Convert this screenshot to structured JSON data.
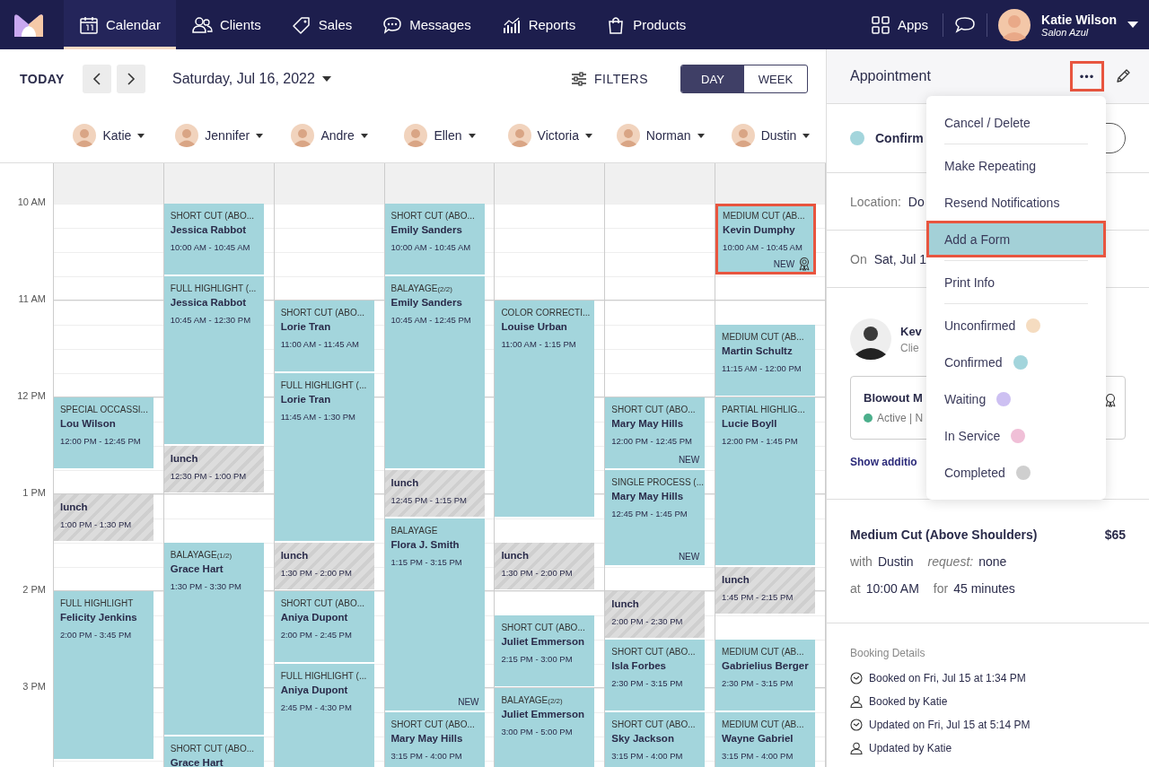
{
  "nav": {
    "items": [
      {
        "label": "Calendar",
        "selected": true
      },
      {
        "label": "Clients",
        "selected": false
      },
      {
        "label": "Sales",
        "selected": false
      },
      {
        "label": "Messages",
        "selected": false
      },
      {
        "label": "Reports",
        "selected": false
      },
      {
        "label": "Products",
        "selected": false
      }
    ],
    "apps": "Apps",
    "user": {
      "name": "Katie Wilson",
      "salon": "Salon Azul"
    }
  },
  "toolbar": {
    "today": "TODAY",
    "date": "Saturday, Jul 16, 2022",
    "filters": "FILTERS",
    "views": [
      {
        "label": "DAY",
        "selected": true
      },
      {
        "label": "WEEK",
        "selected": false
      }
    ]
  },
  "hours": [
    "10 AM",
    "11 AM",
    "12 PM",
    "1 PM",
    "2 PM",
    "3 PM"
  ],
  "staff": [
    {
      "name": "Katie",
      "events": [
        {
          "kind": "appointment",
          "service": "SPECIAL OCCASSI...",
          "client": "Lou Wilson",
          "time": "12:00 PM - 12:45 PM",
          "highlighted": false
        },
        {
          "kind": "break",
          "label": "lunch",
          "time": "1:00 PM - 1:30 PM"
        },
        {
          "kind": "appointment",
          "service": "FULL HIGHLIGHT",
          "client": "Felicity Jenkins",
          "time": "2:00 PM - 3:45 PM",
          "highlighted": false
        }
      ]
    },
    {
      "name": "Jennifer",
      "events": [
        {
          "kind": "appointment",
          "service": "SHORT CUT (ABO...",
          "client": "Jessica Rabbot",
          "time": "10:00 AM - 10:45 AM",
          "highlighted": false
        },
        {
          "kind": "appointment",
          "service": "FULL HIGHLIGHT (...",
          "client": "Jessica Rabbot",
          "time": "10:45 AM - 12:30 PM",
          "highlighted": false
        },
        {
          "kind": "break",
          "label": "lunch",
          "time": "12:30 PM - 1:00 PM"
        },
        {
          "kind": "appointment",
          "service": "BALAYAGE",
          "part": "(1/2)",
          "client": "Grace Hart",
          "time": "1:30 PM - 3:30 PM",
          "highlighted": false
        },
        {
          "kind": "appointment",
          "service": "SHORT CUT (ABO...",
          "client": "Grace Hart",
          "highlighted": false
        }
      ]
    },
    {
      "name": "Andre",
      "events": [
        {
          "kind": "appointment",
          "service": "SHORT CUT (ABO...",
          "client": "Lorie Tran",
          "time": "11:00 AM - 11:45 AM",
          "highlighted": false
        },
        {
          "kind": "appointment",
          "service": "FULL HIGHLIGHT (...",
          "client": "Lorie Tran",
          "time": "11:45 AM - 1:30 PM",
          "highlighted": false
        },
        {
          "kind": "break",
          "label": "lunch",
          "time": "1:30 PM - 2:00 PM"
        },
        {
          "kind": "appointment",
          "service": "SHORT CUT (ABO...",
          "client": "Aniya Dupont",
          "time": "2:00 PM - 2:45 PM",
          "highlighted": false
        },
        {
          "kind": "appointment",
          "service": "FULL HIGHLIGHT (...",
          "client": "Aniya Dupont",
          "time": "2:45 PM - 4:30 PM",
          "highlighted": false
        }
      ]
    },
    {
      "name": "Ellen",
      "events": [
        {
          "kind": "appointment",
          "service": "SHORT CUT (ABO...",
          "client": "Emily Sanders",
          "time": "10:00 AM - 10:45 AM",
          "highlighted": false
        },
        {
          "kind": "appointment",
          "service": "BALAYAGE",
          "part": "(2/2)",
          "client": "Emily Sanders",
          "time": "10:45 AM - 12:45 PM",
          "highlighted": false
        },
        {
          "kind": "break",
          "label": "lunch",
          "time": "12:45 PM - 1:15 PM"
        },
        {
          "kind": "appointment",
          "service": "BALAYAGE",
          "client": "Flora J. Smith",
          "time": "1:15 PM - 3:15 PM",
          "tag": "NEW",
          "highlighted": false
        },
        {
          "kind": "appointment",
          "service": "SHORT CUT (ABO...",
          "client": "Mary May Hills",
          "time": "3:15 PM - 4:00 PM",
          "highlighted": false
        }
      ]
    },
    {
      "name": "Victoria",
      "events": [
        {
          "kind": "appointment",
          "service": "COLOR CORRECTI...",
          "client": "Louise Urban",
          "time": "11:00 AM - 1:15 PM",
          "highlighted": false
        },
        {
          "kind": "break",
          "label": "lunch",
          "time": "1:30 PM - 2:00 PM"
        },
        {
          "kind": "appointment",
          "service": "SHORT CUT (ABO...",
          "client": "Juliet Emmerson",
          "time": "2:15 PM - 3:00 PM",
          "highlighted": false
        },
        {
          "kind": "appointment",
          "service": "BALAYAGE",
          "part": "(2/2)",
          "client": "Juliet Emmerson",
          "time": "3:00 PM - 5:00 PM",
          "highlighted": false
        }
      ]
    },
    {
      "name": "Norman",
      "events": [
        {
          "kind": "appointment",
          "service": "SHORT CUT (ABO...",
          "client": "Mary May Hills",
          "time": "12:00 PM - 12:45 PM",
          "tag": "NEW",
          "highlighted": false
        },
        {
          "kind": "appointment",
          "service": "SINGLE PROCESS (...",
          "client": "Mary May Hills",
          "time": "12:45 PM - 1:45 PM",
          "tag": "NEW",
          "highlighted": false
        },
        {
          "kind": "break",
          "label": "lunch",
          "time": "2:00 PM - 2:30 PM"
        },
        {
          "kind": "appointment",
          "service": "SHORT CUT (ABO...",
          "client": "Isla Forbes",
          "time": "2:30 PM - 3:15 PM",
          "highlighted": false
        },
        {
          "kind": "appointment",
          "service": "SHORT CUT (ABO...",
          "client": "Sky Jackson",
          "time": "3:15 PM - 4:00 PM",
          "highlighted": false
        }
      ]
    },
    {
      "name": "Dustin",
      "events": [
        {
          "kind": "appointment",
          "service": "MEDIUM CUT (AB...",
          "client": "Kevin Dumphy",
          "time": "10:00 AM - 10:45 AM",
          "tag": "NEW",
          "award": true,
          "highlighted": true
        },
        {
          "kind": "appointment",
          "service": "MEDIUM CUT (AB...",
          "client": "Martin Schultz",
          "time": "11:15 AM - 12:00 PM",
          "highlighted": false
        },
        {
          "kind": "appointment",
          "service": "PARTIAL HIGHLIG...",
          "client": "Lucie Boyll",
          "time": "12:00 PM - 1:45 PM",
          "highlighted": false
        },
        {
          "kind": "break",
          "label": "lunch",
          "time": "1:45 PM - 2:15 PM"
        },
        {
          "kind": "appointment",
          "service": "MEDIUM CUT (AB...",
          "client": "Gabrielius Berger",
          "time": "2:30 PM - 3:15 PM",
          "highlighted": false
        },
        {
          "kind": "appointment",
          "service": "MEDIUM CUT (AB...",
          "client": "Wayne Gabriel",
          "time": "3:15 PM - 4:00 PM",
          "highlighted": false
        }
      ]
    }
  ],
  "panel": {
    "title": "Appointment",
    "more": {
      "label": "•••",
      "highlighted": true
    },
    "status": {
      "label": "Confirm",
      "color": "#a3d5dc"
    },
    "location": {
      "label": "Location:",
      "value": "Do"
    },
    "date": {
      "label": "On",
      "value": "Sat, Jul 1"
    },
    "client": {
      "name": "Kev",
      "role": "Clie",
      "card": {
        "title": "Blowout M",
        "status": "Active | N"
      },
      "more_link": "Show additio"
    },
    "service": {
      "name": "Medium Cut (Above Shoulders)",
      "price": "$65",
      "with_label": "with",
      "with": "Dustin",
      "request_label": "request:",
      "request": "none",
      "at_label": "at",
      "at": "10:00 AM",
      "for_label": "for",
      "for": "45 minutes"
    },
    "booking": {
      "title": "Booking Details",
      "rows": [
        {
          "kind": "time",
          "text": "Booked on Fri, Jul 15 at 1:34 PM"
        },
        {
          "kind": "person",
          "text": "Booked by Katie"
        },
        {
          "kind": "time",
          "text": "Updated on Fri, Jul 15 at 5:14 PM"
        },
        {
          "kind": "person",
          "text": "Updated by Katie"
        }
      ]
    }
  },
  "menu": {
    "groups": [
      [
        {
          "label": "Cancel / Delete",
          "highlighted": false
        }
      ],
      [
        {
          "label": "Make Repeating",
          "highlighted": false
        },
        {
          "label": "Resend Notifications",
          "highlighted": false
        },
        {
          "label": "Add a Form",
          "highlighted": true
        }
      ],
      [
        {
          "label": "Print Info",
          "highlighted": false
        }
      ],
      [
        {
          "label": "Unconfirmed",
          "color": "#f5dcc0",
          "highlighted": false
        },
        {
          "label": "Confirmed",
          "color": "#a3d5dc",
          "highlighted": false
        },
        {
          "label": "Waiting",
          "color": "#cdc0f2",
          "highlighted": false
        },
        {
          "label": "In Service",
          "color": "#f0bfd7",
          "highlighted": false
        },
        {
          "label": "Completed",
          "color": "#cfcfcf",
          "highlighted": false
        }
      ]
    ]
  }
}
